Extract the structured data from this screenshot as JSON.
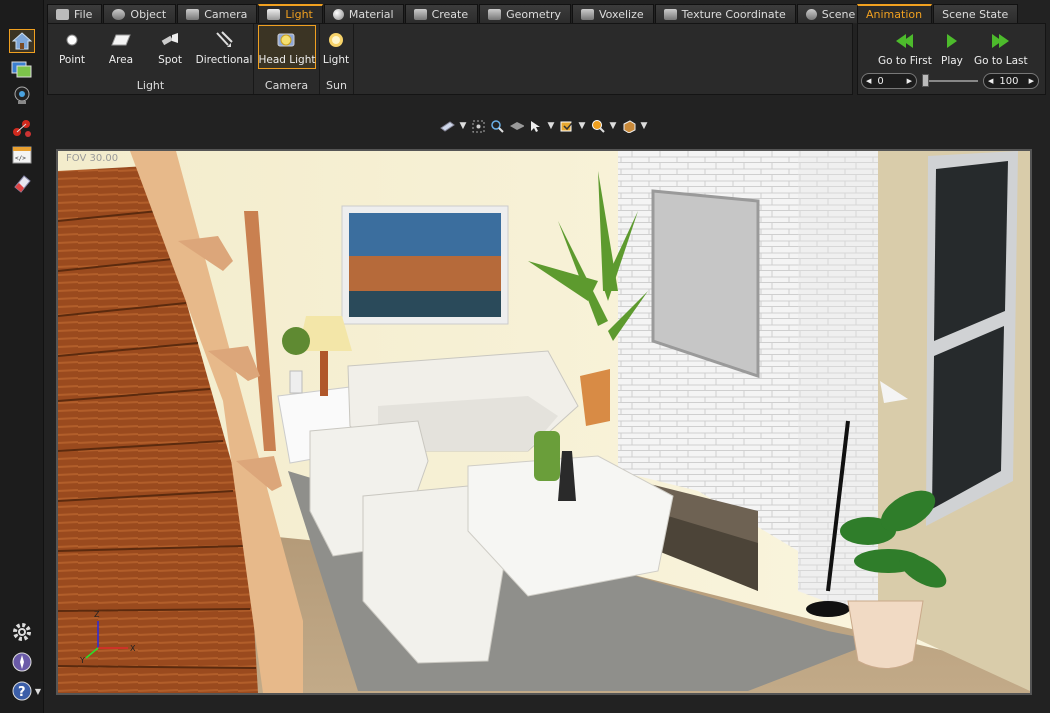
{
  "tabs": [
    {
      "label": "File",
      "icon": "folder-icon"
    },
    {
      "label": "Object",
      "icon": "object-icon"
    },
    {
      "label": "Camera",
      "icon": "camera-icon"
    },
    {
      "label": "Light",
      "icon": "flashlight-icon"
    },
    {
      "label": "Material",
      "icon": "material-sphere-icon"
    },
    {
      "label": "Create",
      "icon": "create-icon"
    },
    {
      "label": "Geometry",
      "icon": "geometry-icon"
    },
    {
      "label": "Voxelize",
      "icon": "voxelize-icon"
    },
    {
      "label": "Texture Coordinate",
      "icon": "texture-coordinate-icon"
    },
    {
      "label": "Scene States",
      "icon": "scene-states-icon"
    }
  ],
  "active_tab": "Light",
  "ribbon": {
    "light_group": {
      "label": "Light",
      "buttons": [
        {
          "label": "Point",
          "icon": "point-light-icon"
        },
        {
          "label": "Area",
          "icon": "area-light-icon"
        },
        {
          "label": "Spot",
          "icon": "spot-light-icon"
        },
        {
          "label": "Directional",
          "icon": "directional-light-icon"
        }
      ]
    },
    "camera_group": {
      "label": "Camera",
      "button": {
        "label": "Head Light",
        "icon": "head-light-icon"
      }
    },
    "sun_group": {
      "label": "Sun",
      "button": {
        "label": "Light",
        "icon": "sun-icon"
      }
    }
  },
  "animation": {
    "tabs": [
      {
        "label": "Animation"
      },
      {
        "label": "Scene State"
      }
    ],
    "go_first": "Go to First",
    "play": "Play",
    "go_last": "Go to Last",
    "start_frame": "0",
    "end_frame": "100",
    "slider_position": 0
  },
  "viewport": {
    "fov_label": "FOV 30.00",
    "axis_x": "X",
    "axis_y": "Y",
    "axis_z": "Z"
  },
  "colors": {
    "accent": "#f0a020",
    "play_green": "#4dbb2c"
  }
}
